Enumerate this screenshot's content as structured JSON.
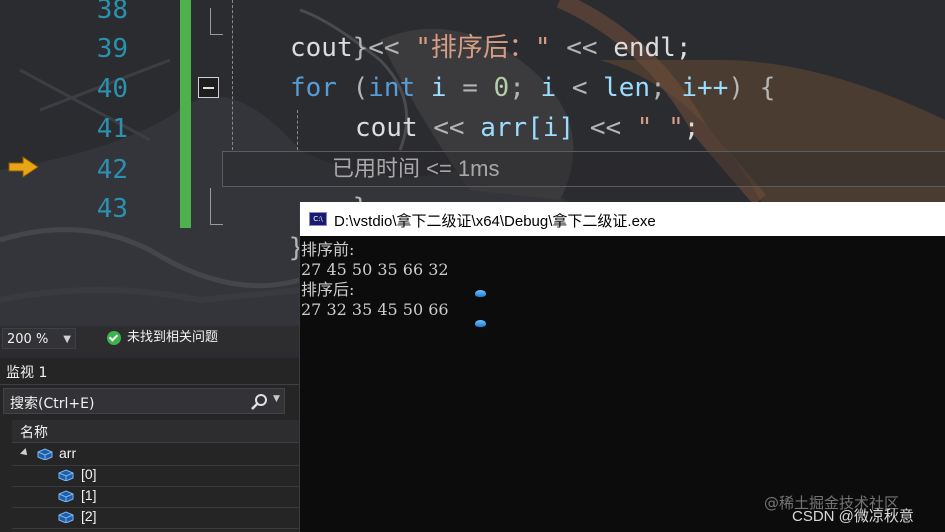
{
  "editor": {
    "line_numbers": [
      "38",
      "39",
      "40",
      "41",
      "42",
      "43"
    ],
    "code": {
      "l38_brace": "}",
      "l39": {
        "cout": "cout",
        "op1": "<<",
        "str": "\"排序后：\"",
        "op2": "<<",
        "endl": "endl",
        "semi": ";"
      },
      "l40": {
        "for": "for",
        "p1": "(",
        "int": "int",
        "i1": "i",
        "eq": "=",
        "zero": "0",
        "s1": ";",
        "i2": "i",
        "lt": "<",
        "len": "len",
        "s2": ";",
        "i3": "i++",
        "p2": ")",
        "brace": "{"
      },
      "l41": {
        "cout": "cout",
        "op1": "<<",
        "arr": "arr[i]",
        "op2": "<<",
        "str": "\" \"",
        "semi": ";"
      },
      "l42_brace": "}",
      "l43_brace": "}"
    },
    "perf_tip": "已用时间 <= 1ms",
    "exec_arrow_icon": "current-statement-arrow-icon"
  },
  "status": {
    "zoom": "200 %",
    "issues": "未找到相关问题"
  },
  "watch": {
    "title": "监视 1",
    "search_placeholder": "搜索(Ctrl+E)",
    "column_name": "名称",
    "rows": [
      {
        "label": "arr",
        "expanded": true
      },
      {
        "label": "[0]"
      },
      {
        "label": "[1]"
      },
      {
        "label": "[2]"
      }
    ]
  },
  "console": {
    "title": "D:\\vstdio\\拿下二级证\\x64\\Debug\\拿下二级证.exe",
    "icon_label": "C:\\",
    "lines": [
      "排序前:",
      "27 45 50 35 66 32",
      "排序后:",
      "27 32 35 45 50 66"
    ]
  },
  "watermark": {
    "line1": "@稀土掘金技术社区",
    "line2": "CSDN @微凉秋意"
  },
  "colors": {
    "keyword": "#569cd6",
    "string": "#d69d85",
    "line_number": "#2b91af",
    "change_bar": "#4fb04d",
    "exec_arrow": "#e8a617",
    "console_bg": "#0c0c0c"
  }
}
